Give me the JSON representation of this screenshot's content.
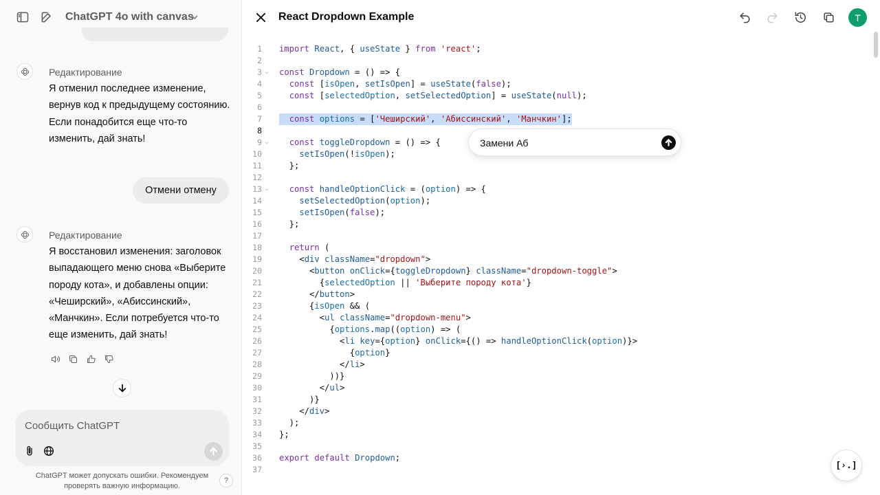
{
  "sidebar": {
    "model_title": "ChatGPT 4o with canvas"
  },
  "conversation": {
    "messages": [
      {
        "role": "assistant",
        "label": "Редактирование",
        "text": "Я отменил последнее изменение, вернув код к предыдущему состоянию. Если понадобится еще что-то изменить, дай знать!"
      },
      {
        "role": "user",
        "text": "Отмени отмену"
      },
      {
        "role": "assistant",
        "label": "Редактирование",
        "text": "Я восстановил изменения: заголовок выпадающего меню снова «Выберите породу кота», и добавлены опции: «Чеширский», «Абиссинский», «Манчкин». Если потребуется что-то еще изменить, дай знать!"
      }
    ]
  },
  "composer": {
    "placeholder": "Сообщить ChatGPT",
    "disclaimer": "ChatGPT может допускать ошибки. Рекомендуем проверять важную информацию.",
    "help_label": "?"
  },
  "canvas": {
    "title": "React Dropdown Example",
    "user_initial": "T",
    "edit_prompt_value": "Замени Аб",
    "code_review_label": "[›.]",
    "highlighted_line": 7,
    "active_line": 8,
    "code_lines": [
      "import React, { useState } from 'react';",
      "",
      "const Dropdown = () => {",
      "  const [isOpen, setIsOpen] = useState(false);",
      "  const [selectedOption, setSelectedOption] = useState(null);",
      "",
      "  const options = ['Чеширский', 'Абиссинский', 'Манчкин'];",
      "",
      "  const toggleDropdown = () => {",
      "    setIsOpen(!isOpen);",
      "  };",
      "",
      "  const handleOptionClick = (option) => {",
      "    setSelectedOption(option);",
      "    setIsOpen(false);",
      "  };",
      "",
      "  return (",
      "    <div className=\"dropdown\">",
      "      <button onClick={toggleDropdown} className=\"dropdown-toggle\">",
      "        {selectedOption || 'Выберите породу кота'}",
      "      </button>",
      "      {isOpen && (",
      "        <ul className=\"dropdown-menu\">",
      "          {options.map((option) => (",
      "            <li key={option} onClick={() => handleOptionClick(option)}>",
      "              {option}",
      "            </li>",
      "          ))}",
      "        </ul>",
      "      )}",
      "    </div>",
      "  );",
      "};",
      "",
      "export default Dropdown;",
      ""
    ],
    "fold_lines": [
      3,
      9,
      13
    ]
  }
}
